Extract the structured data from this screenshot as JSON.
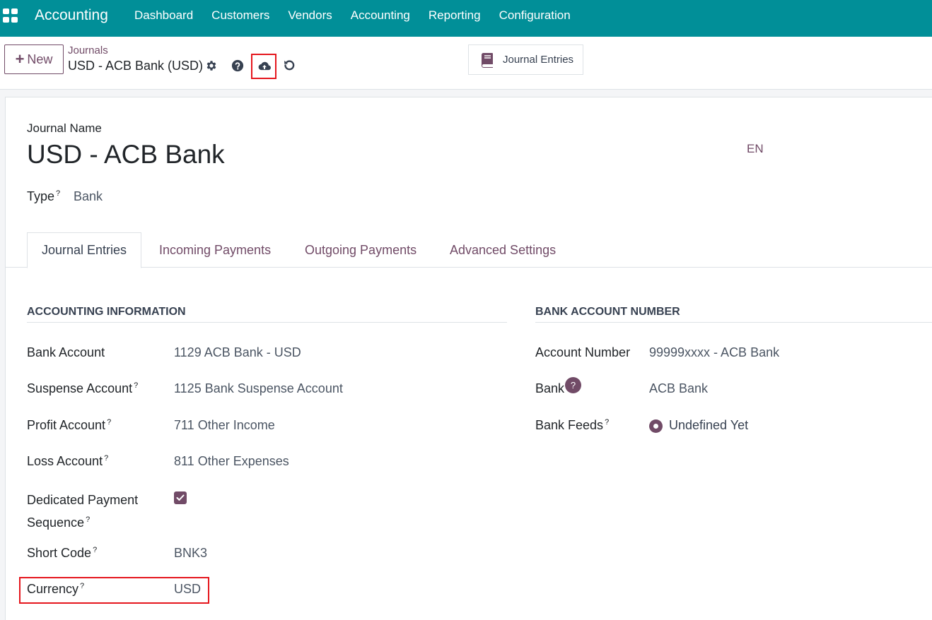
{
  "navbar": {
    "app_name": "Accounting",
    "menu": [
      "Dashboard",
      "Customers",
      "Vendors",
      "Accounting",
      "Reporting",
      "Configuration"
    ]
  },
  "control": {
    "new_label": "New",
    "breadcrumb_parent": "Journals",
    "breadcrumb_current": "USD - ACB Bank (USD)",
    "smart_button": "Journal Entries"
  },
  "form": {
    "name_label": "Journal Name",
    "name": "USD - ACB Bank",
    "lang": "EN",
    "type_label": "Type",
    "type_value": "Bank"
  },
  "tabs": [
    "Journal Entries",
    "Incoming Payments",
    "Outgoing Payments",
    "Advanced Settings"
  ],
  "accounting": {
    "title": "ACCOUNTING INFORMATION",
    "bank_account_label": "Bank Account",
    "bank_account_value": "1129 ACB Bank - USD",
    "suspense_label": "Suspense Account",
    "suspense_value": "1125 Bank Suspense Account",
    "profit_label": "Profit Account",
    "profit_value": "711 Other Income",
    "loss_label": "Loss Account",
    "loss_value": "811 Other Expenses",
    "dedicated_label_1": "Dedicated Payment",
    "dedicated_label_2": "Sequence",
    "short_code_label": "Short Code",
    "short_code_value": "BNK3",
    "currency_label": "Currency",
    "currency_value": "USD"
  },
  "bank_account": {
    "title": "BANK ACCOUNT NUMBER",
    "account_number_label": "Account Number",
    "account_number_value": "99999xxxx - ACB Bank",
    "bank_label": "Bank",
    "bank_value": "ACB Bank",
    "feeds_label": "Bank Feeds",
    "feeds_value": "Undefined Yet"
  },
  "colors": {
    "navbar": "#018f98",
    "primary": "#714b67",
    "highlight": "#e5161d"
  }
}
